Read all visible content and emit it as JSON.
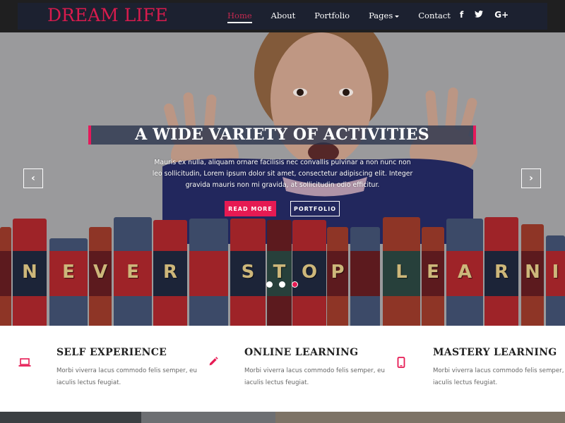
{
  "header": {
    "logo": "DREAM LIFE",
    "nav": [
      {
        "label": "Home",
        "active": true
      },
      {
        "label": "About"
      },
      {
        "label": "Portfolio"
      },
      {
        "label": "Pages",
        "dropdown": true
      },
      {
        "label": "Contact"
      }
    ],
    "social": [
      {
        "icon": "facebook-icon",
        "glyph": "f"
      },
      {
        "icon": "twitter-icon",
        "glyph": "🐦"
      },
      {
        "icon": "google-plus-icon",
        "glyph": "G+"
      }
    ]
  },
  "hero": {
    "title": "A WIDE VARIETY OF ACTIVITIES",
    "text": "Mauris ex nulla, aliquam ornare facilisis nec convallis pulvinar a non nunc non leo sollicitudin, Lorem ipsum dolor sit amet, consectetur adipiscing elit. Integer gravida mauris non mi gravida, at sollicitudin odio efficitur.",
    "primary_button": "READ MORE",
    "secondary_button": "PORTFOLIO",
    "prev_arrow": "‹",
    "next_arrow": "›",
    "slides": 3,
    "active_slide": 3,
    "book_letters": [
      "N",
      "E",
      "V",
      "E",
      "R",
      "",
      "S",
      "T",
      "O",
      "P",
      "",
      "L",
      "E",
      "A",
      "R",
      "N",
      "I"
    ]
  },
  "features": [
    {
      "icon": "laptop-icon",
      "title": "SELF EXPERIENCE",
      "text": "Morbi viverra lacus commodo felis semper, eu iaculis lectus feugiat."
    },
    {
      "icon": "pencil-icon",
      "title": "ONLINE LEARNING",
      "text": "Morbi viverra lacus commodo felis semper, eu iaculis lectus feugiat."
    },
    {
      "icon": "mobile-icon",
      "title": "MASTERY LEARNING",
      "text": "Morbi viverra lacus commodo felis semper, eu iaculis lectus feugiat."
    }
  ],
  "colors": {
    "accent": "#e61a53",
    "nav_bg": "#1c2130",
    "topbar_bg": "#1f1f20"
  }
}
